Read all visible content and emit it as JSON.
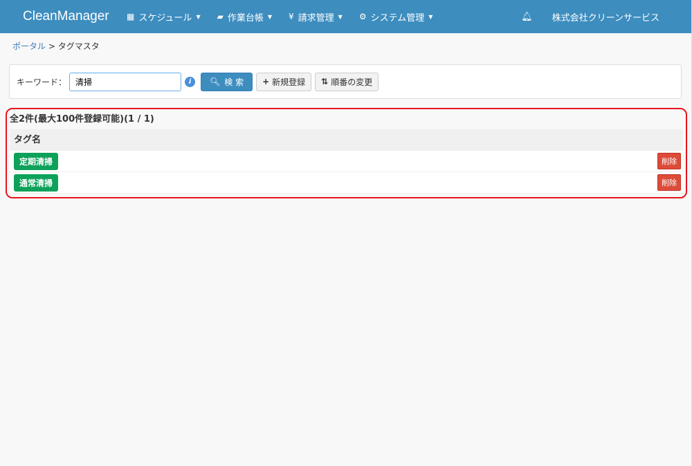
{
  "header": {
    "brand": "CleanManager",
    "menus": [
      {
        "label": "スケジュール",
        "icon": "calendar-icon"
      },
      {
        "label": "作業台帳",
        "icon": "book-icon"
      },
      {
        "label": "請求管理",
        "icon": "yen-icon"
      },
      {
        "label": "システム管理",
        "icon": "gears-icon"
      }
    ],
    "company": "株式会社クリーンサービス"
  },
  "breadcrumb": {
    "home": "ポータル",
    "separator": ">",
    "current": "タグマスタ"
  },
  "search": {
    "label": "キーワード：",
    "value": "清掃",
    "search_label": "検 索",
    "new_label": "新規登録",
    "order_label": "順番の変更"
  },
  "list": {
    "summary": "全2件(最大100件登録可能)(1 / 1)",
    "column": "タグ名",
    "rows": [
      {
        "name": "定期清掃",
        "delete": "削除"
      },
      {
        "name": "通常清掃",
        "delete": "削除"
      }
    ]
  },
  "colors": {
    "nav": "#3d8dbf",
    "tag": "#0da15a",
    "delete": "#dd4b39",
    "highlight": "#e8141d"
  }
}
